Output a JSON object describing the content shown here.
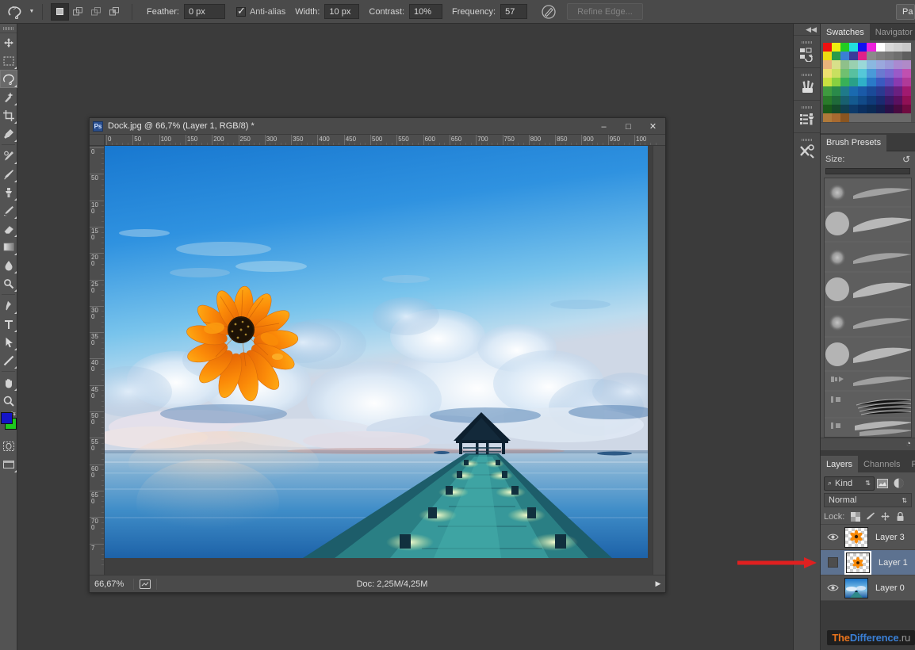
{
  "app": {
    "name": "Adobe Photoshop"
  },
  "options_bar": {
    "tool_icon": "magnetic-lasso-icon",
    "tool_preset_arrow": "▾",
    "selection_modes": [
      {
        "name": "new-selection",
        "icon": "square-icon",
        "active": true
      },
      {
        "name": "add-to-selection",
        "icon": "squares-union-icon",
        "active": false
      },
      {
        "name": "subtract-from-selection",
        "icon": "squares-subtract-icon",
        "active": false
      },
      {
        "name": "intersect-with-selection",
        "icon": "squares-intersect-icon",
        "active": false
      }
    ],
    "feather_label": "Feather:",
    "feather_value": "0 px",
    "antialias_label": "Anti-alias",
    "antialias_checked": true,
    "width_label": "Width:",
    "width_value": "10 px",
    "contrast_label": "Contrast:",
    "contrast_value": "10%",
    "frequency_label": "Frequency:",
    "frequency_value": "57",
    "pen_pressure_icon": "pen-pressure-icon",
    "refine_edge_label": "Refine Edge...",
    "right_button_label": "Pa"
  },
  "toolbar": {
    "items": [
      {
        "name": "move-tool",
        "icon": "move-icon",
        "has_submenu": false,
        "selected": false
      },
      {
        "name": "rectangular-marquee-tool",
        "icon": "marquee-icon",
        "has_submenu": true,
        "selected": false
      },
      {
        "name": "lasso-tool",
        "icon": "lasso-icon",
        "has_submenu": true,
        "selected": true
      },
      {
        "name": "quick-selection-tool",
        "icon": "quick-select-icon",
        "has_submenu": true,
        "selected": false
      },
      {
        "name": "crop-tool",
        "icon": "crop-icon",
        "has_submenu": true,
        "selected": false
      },
      {
        "name": "eyedropper-tool",
        "icon": "eyedropper-icon",
        "has_submenu": true,
        "selected": false
      },
      {
        "name": "spot-healing-brush-tool",
        "icon": "healing-brush-icon",
        "has_submenu": true,
        "selected": false
      },
      {
        "name": "brush-tool",
        "icon": "brush-icon",
        "has_submenu": true,
        "selected": false
      },
      {
        "name": "clone-stamp-tool",
        "icon": "clone-stamp-icon",
        "has_submenu": true,
        "selected": false
      },
      {
        "name": "history-brush-tool",
        "icon": "history-brush-icon",
        "has_submenu": true,
        "selected": false
      },
      {
        "name": "eraser-tool",
        "icon": "eraser-icon",
        "has_submenu": true,
        "selected": false
      },
      {
        "name": "gradient-tool",
        "icon": "gradient-icon",
        "has_submenu": true,
        "selected": false
      },
      {
        "name": "blur-tool",
        "icon": "blur-drop-icon",
        "has_submenu": true,
        "selected": false
      },
      {
        "name": "dodge-tool",
        "icon": "dodge-icon",
        "has_submenu": true,
        "selected": false
      },
      {
        "name": "pen-tool",
        "icon": "pen-icon",
        "has_submenu": true,
        "selected": false
      },
      {
        "name": "horizontal-type-tool",
        "icon": "type-t-icon",
        "has_submenu": true,
        "selected": false
      },
      {
        "name": "path-selection-tool",
        "icon": "path-arrow-icon",
        "has_submenu": true,
        "selected": false
      },
      {
        "name": "line-tool",
        "icon": "line-shape-icon",
        "has_submenu": true,
        "selected": false
      },
      {
        "name": "hand-tool",
        "icon": "hand-icon",
        "has_submenu": true,
        "selected": false
      },
      {
        "name": "zoom-tool",
        "icon": "magnifier-icon",
        "has_submenu": false,
        "selected": false
      }
    ],
    "swap_colors_icon": "swap-arrows-icon",
    "foreground_color": "#1414c8",
    "background_color": "#1ec81e",
    "quick_mask_icon": "quick-mask-icon",
    "screen_mode_icon": "screen-mode-icon"
  },
  "document": {
    "title": "Dock.jpg @ 66,7% (Layer 1, RGB/8) *",
    "app_badge": "Ps",
    "window_controls": {
      "minimize": "–",
      "maximize": "□",
      "close": "✕"
    },
    "ruler_h_labels": [
      "0",
      "50",
      "100",
      "150",
      "200",
      "250",
      "300",
      "350",
      "400",
      "450",
      "500",
      "550",
      "600",
      "650",
      "700",
      "750",
      "800",
      "850",
      "900",
      "950",
      "100"
    ],
    "ruler_v_labels": [
      "0",
      "50",
      "100",
      "150",
      "200",
      "250",
      "300",
      "350",
      "400",
      "450",
      "500",
      "550",
      "600",
      "650",
      "700",
      "7"
    ],
    "status": {
      "zoom": "66,67%",
      "icon": "document-thumb-icon",
      "doc_info": "Doc: 2,25M/4,25M",
      "play_icon": "▶"
    }
  },
  "dock_strip": {
    "collapse_icon": "◀◀",
    "items": [
      {
        "name": "history-panel-icon",
        "icon": "history-icon"
      },
      {
        "name": "brush-panel-icon",
        "icon": "brush-tips-icon"
      },
      {
        "name": "clone-source-panel-icon",
        "icon": "clone-source-icon"
      },
      {
        "name": "tool-presets-panel-icon",
        "icon": "tools-cross-icon"
      }
    ]
  },
  "swatches_panel": {
    "tabs": [
      {
        "label": "Swatches",
        "active": true
      },
      {
        "label": "Navigator",
        "active": false
      }
    ],
    "colors": [
      "#ee1111",
      "#eeee11",
      "#22cc22",
      "#22dddd",
      "#1111ee",
      "#ee22dd",
      "#ffffff",
      "#d8d8d8",
      "#d0d0d0",
      "#c8c8c8",
      "#eedd11",
      "#2a9a4a",
      "#3a7fd5",
      "#3a3a9a",
      "#e0208a",
      "#8a8a8a",
      "#7e7e7e",
      "#777777",
      "#6e6e6e",
      "#5e5e5e",
      "#eab37a",
      "#d8e08a",
      "#8fc08a",
      "#9ad0b0",
      "#9ad8d8",
      "#8ab8e0",
      "#9aa8dd",
      "#9a9ad8",
      "#aa8ad0",
      "#b08ac8",
      "#eee070",
      "#c8e060",
      "#70c070",
      "#58c0a0",
      "#55c8d8",
      "#4a9ad8",
      "#6a7ad0",
      "#7a6ad0",
      "#9a5ac8",
      "#c050b0",
      "#c8e040",
      "#88d040",
      "#38b058",
      "#2aa088",
      "#2fb0c8",
      "#2a7ac8",
      "#3a5ac0",
      "#5a4ab8",
      "#8a3ab0",
      "#b03a98",
      "#3f9a3f",
      "#2a8a4a",
      "#1f7a8a",
      "#1a6ab0",
      "#1a5aa8",
      "#1a4a98",
      "#2a3a90",
      "#4a2a88",
      "#6a2080",
      "#a01a70",
      "#2a7a2a",
      "#1f6a3a",
      "#186070",
      "#145a90",
      "#114a88",
      "#0f3a78",
      "#1a2a70",
      "#3a1a68",
      "#5a1060",
      "#901055",
      "#1a5a1a",
      "#144a2a",
      "#104050",
      "#0d3a6a",
      "#0a2f60",
      "#0a2a55",
      "#141f50",
      "#2a1048",
      "#480a40",
      "#700a40",
      "#b07a3a",
      "#a86a30",
      "#8a5520",
      "#6a6a6a",
      "#6a6a6a",
      "#6a6a6a",
      "#6a6a6a",
      "#6a6a6a",
      "#6a6a6a",
      "#6a6a6a"
    ]
  },
  "brush_panel": {
    "tab_label": "Brush Presets",
    "size_label": "Size:",
    "reset_icon": "reset-arrow-icon",
    "slider_value": 0,
    "footer_icon": "new-brush-icon"
  },
  "layers_panel": {
    "tabs": [
      {
        "label": "Layers",
        "active": true
      },
      {
        "label": "Channels",
        "active": false
      },
      {
        "label": "Pa",
        "active": false
      }
    ],
    "filter": {
      "kind_label": "Kind",
      "search_icon": "magnifier-icon",
      "spinner_icon": "▲▼",
      "filter_icons": [
        "image-filter-icon",
        "adjustment-filter-icon"
      ]
    },
    "blend_mode": "Normal",
    "lock": {
      "label": "Lock:",
      "icons": [
        "lock-transparency-icon",
        "lock-image-pixels-icon",
        "lock-position-icon",
        "lock-all-icon"
      ]
    },
    "layers": [
      {
        "name": "Layer 3",
        "visible": true,
        "selected": false,
        "thumb": "flower-transparent"
      },
      {
        "name": "Layer 1",
        "visible": false,
        "selected": true,
        "thumb": "flower-transparent"
      },
      {
        "name": "Layer 0",
        "visible": true,
        "selected": false,
        "thumb": "dock-photo"
      }
    ]
  },
  "annotation": {
    "arrow_color": "#e02020",
    "arrow_target": "layer-1-visibility-checkbox"
  },
  "watermark": {
    "part1": "The",
    "part2": "Difference",
    "part3": ".ru"
  }
}
